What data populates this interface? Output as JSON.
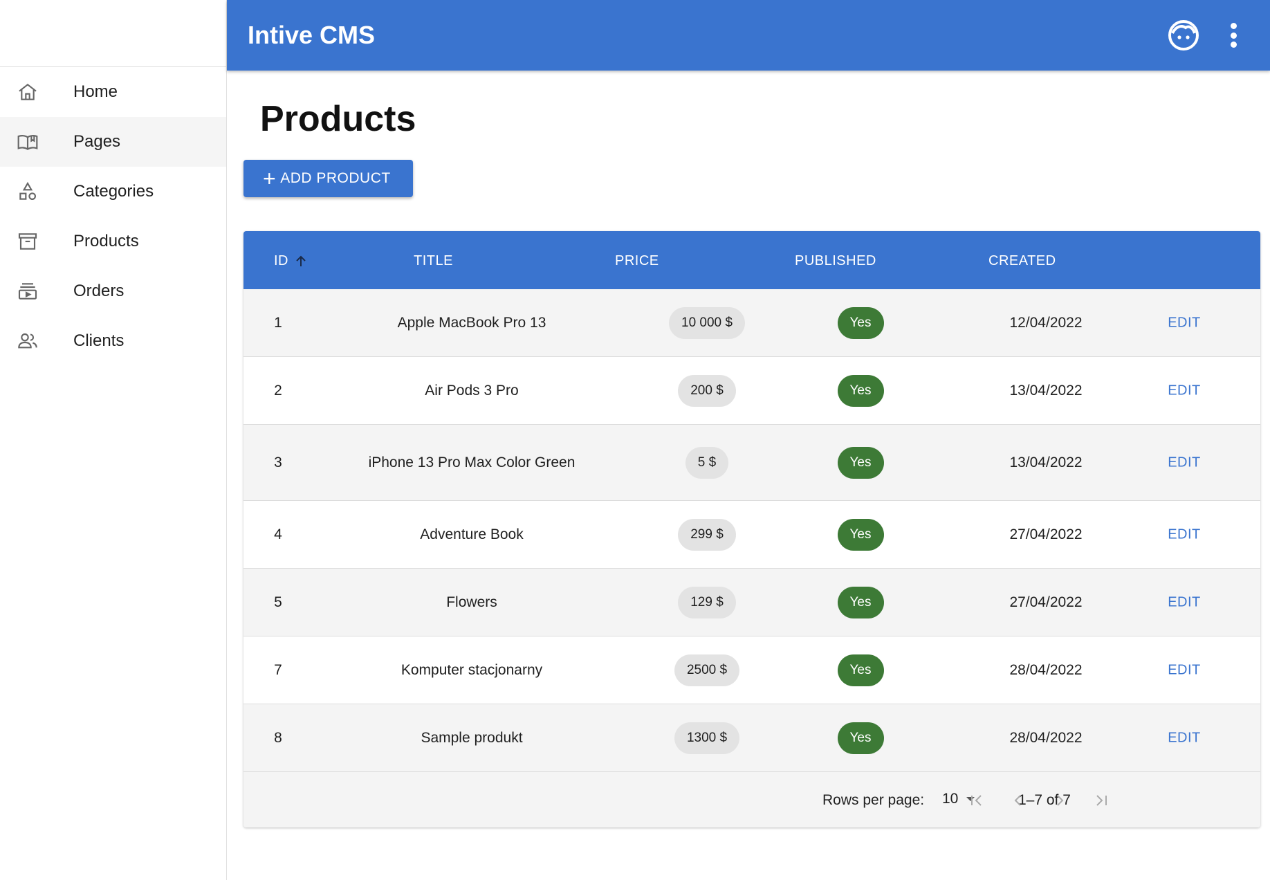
{
  "app": {
    "title": "Intive CMS"
  },
  "sidebar": {
    "items": [
      {
        "label": "Home",
        "icon": "home-icon",
        "active": false
      },
      {
        "label": "Pages",
        "icon": "book-icon",
        "active": true
      },
      {
        "label": "Categories",
        "icon": "shapes-icon",
        "active": false
      },
      {
        "label": "Products",
        "icon": "archive-icon",
        "active": false
      },
      {
        "label": "Orders",
        "icon": "subscriptions-icon",
        "active": false
      },
      {
        "label": "Clients",
        "icon": "people-icon",
        "active": false
      }
    ]
  },
  "page": {
    "title": "Products",
    "add_button_label": "ADD PRODUCT"
  },
  "table": {
    "columns": [
      "ID",
      "TITLE",
      "PRICE",
      "PUBLISHED",
      "CREATED"
    ],
    "sort_column": "ID",
    "sort_direction": "ascending",
    "edit_label": "EDIT",
    "rows": [
      {
        "id": "1",
        "title": "Apple MacBook Pro 13",
        "price": "10 000 $",
        "published": "Yes",
        "created": "12/04/2022"
      },
      {
        "id": "2",
        "title": "Air Pods 3 Pro",
        "price": "200 $",
        "published": "Yes",
        "created": "13/04/2022"
      },
      {
        "id": "3",
        "title": "iPhone 13 Pro Max Color Green",
        "price": "5 $",
        "published": "Yes",
        "created": "13/04/2022"
      },
      {
        "id": "4",
        "title": "Adventure Book",
        "price": "299 $",
        "published": "Yes",
        "created": "27/04/2022"
      },
      {
        "id": "5",
        "title": "Flowers",
        "price": "129 $",
        "published": "Yes",
        "created": "27/04/2022"
      },
      {
        "id": "7",
        "title": "Komputer stacjonarny",
        "price": "2500 $",
        "published": "Yes",
        "created": "28/04/2022"
      },
      {
        "id": "8",
        "title": "Sample produkt",
        "price": "1300 $",
        "published": "Yes",
        "created": "28/04/2022"
      }
    ]
  },
  "pagination": {
    "rows_per_page_label": "Rows per page:",
    "rows_per_page": "10",
    "range": "1–7 of 7"
  },
  "colors": {
    "primary": "#3a74cf",
    "published_chip": "#3d7a36",
    "price_chip": "#e3e3e3",
    "row_alt": "#f4f4f4"
  }
}
